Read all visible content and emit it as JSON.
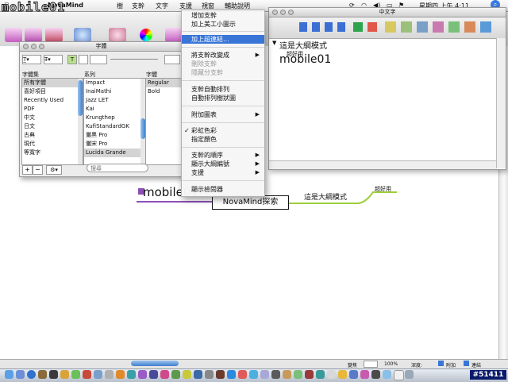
{
  "menubar": {
    "app_name": "NovaMind",
    "items": [
      "樹",
      "支幹",
      "文字",
      "支援",
      "視窗",
      "輔助說明"
    ],
    "clock": "星期四 上午 4:11",
    "watermark": "mobile01"
  },
  "font_panel": {
    "title": "字體",
    "col_headers": [
      "字體集",
      "系列",
      "字體"
    ],
    "collections": [
      "所有字體",
      "喜好項目",
      "Recently Used",
      "PDF",
      "中文",
      "日文",
      "古典",
      "現代",
      "等寬字"
    ],
    "families": [
      "Impact",
      "InaiMathi",
      "Jazz LET",
      "Kai",
      "Krungthep",
      "KufiStandardGK",
      "儷黑 Pro",
      "儷宋 Pro",
      "Lucida Grande"
    ],
    "typefaces": [
      "Regular",
      "Bold"
    ],
    "search_placeholder": "搜尋",
    "add_label": "+",
    "remove_label": "−",
    "action_label": "⚙▾"
  },
  "outline": {
    "title": "中文字",
    "item_label": "這是大綱模式",
    "sub_label": "超好用",
    "node_label": "mobile01"
  },
  "context_menu": {
    "items": [
      {
        "label": "增加支幹",
        "state": "normal"
      },
      {
        "label": "加上美工小圖示",
        "state": "normal"
      },
      {
        "label": "sep"
      },
      {
        "label": "加上超連結...",
        "state": "highlight"
      },
      {
        "label": "sep"
      },
      {
        "label": "將支幹改變成",
        "state": "normal",
        "submenu": true
      },
      {
        "label": "刪除支幹",
        "state": "disabled"
      },
      {
        "label": "隱藏分支幹",
        "state": "disabled"
      },
      {
        "label": "sep"
      },
      {
        "label": "支幹自動排列",
        "state": "normal"
      },
      {
        "label": "自動排列樹狀圖",
        "state": "normal"
      },
      {
        "label": "sep"
      },
      {
        "label": "附加圖表",
        "state": "normal",
        "submenu": true
      },
      {
        "label": "sep"
      },
      {
        "label": "彩虹色彩",
        "state": "checked"
      },
      {
        "label": "指定顏色",
        "state": "normal"
      },
      {
        "label": "sep"
      },
      {
        "label": "支幹的順序",
        "state": "normal",
        "submenu": true
      },
      {
        "label": "顯示大綱編號",
        "state": "normal"
      },
      {
        "label": "支援",
        "state": "normal",
        "submenu": true
      },
      {
        "label": "sep"
      },
      {
        "label": "顯示檢閱器",
        "state": "normal"
      }
    ]
  },
  "mindmap": {
    "root": "mobile01",
    "center": "NovaMind探索",
    "branch": "這是大綱模式",
    "leaf": "超好用"
  },
  "statusbar": {
    "zoom_label": "變焦",
    "zoom_value": "100%",
    "level_label": "深度:",
    "attach_label": "附加",
    "link_label": "連結"
  },
  "corner_watermark": "#51411",
  "colors": {
    "highlight": "#3875d7",
    "branch_green": "#9ccf3a",
    "root_purple": "#8e4fb5"
  }
}
